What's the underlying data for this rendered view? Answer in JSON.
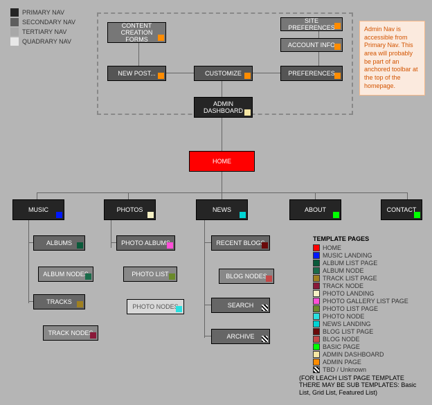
{
  "nav_legend": [
    {
      "label": "PRIMARY NAV",
      "color": "#252525"
    },
    {
      "label": "SECONDARY NAV",
      "color": "#5e5e5e"
    },
    {
      "label": "TERTIARY NAV",
      "color": "#a8a8a8"
    },
    {
      "label": "QUADRARY NAV",
      "color": "#e8e8e8"
    }
  ],
  "annotation": "Admin Nav is accessible from Primary Nav. This area will probably be part of an anchored toolbar at the top of the homepage.",
  "nodes": {
    "content_creation": {
      "label": "CONTENT CREATION FORMS",
      "bg": "#777",
      "badge": "#ff8c00"
    },
    "site_prefs": {
      "label": "SITE PREFERENCES",
      "bg": "#777",
      "badge": "#ff8c00"
    },
    "account_info": {
      "label": "ACCOUNT INFO",
      "bg": "#777",
      "badge": "#ff8c00"
    },
    "new_post": {
      "label": "NEW POST...",
      "bg": "#555",
      "badge": "#ff8c00"
    },
    "customize": {
      "label": "CUSTOMIZE",
      "bg": "#555",
      "badge": "#ff8c00"
    },
    "preferences": {
      "label": "PREFERENCES",
      "bg": "#555",
      "badge": "#ff8c00"
    },
    "admin_dash": {
      "label": "ADMIN DASHBOARD",
      "bg": "#252525",
      "badge": "#f5e6a3"
    },
    "home": {
      "label": "HOME",
      "bg": "#ff0000",
      "badge": ""
    },
    "music": {
      "label": "MUSIC",
      "bg": "#252525",
      "badge": "#0018ff"
    },
    "photos": {
      "label": "PHOTOS",
      "bg": "#252525",
      "badge": "#f5f0c4"
    },
    "news": {
      "label": "NEWS",
      "bg": "#252525",
      "badge": "#00d4d4"
    },
    "about": {
      "label": "ABOUT",
      "bg": "#252525",
      "badge": "#00ff00"
    },
    "contact": {
      "label": "CONTACT",
      "bg": "#252525",
      "badge": "#00ff00"
    },
    "albums": {
      "label": "ALBUMS",
      "bg": "#666",
      "badge": "#0a5a3a"
    },
    "album_nodes": {
      "label": "ALBUM NODES",
      "bg": "#888",
      "badge": "#1a6b4a"
    },
    "tracks": {
      "label": "TRACKS",
      "bg": "#666",
      "badge": "#a08020"
    },
    "track_nodes": {
      "label": "TRACK NODES",
      "bg": "#888",
      "badge": "#8a1a3a"
    },
    "photo_albums": {
      "label": "PHOTO ALBUMS",
      "bg": "#666",
      "badge": "#ff4fd8"
    },
    "photo_list": {
      "label": "PHOTO LIST",
      "bg": "#888",
      "badge": "#6a8a2a"
    },
    "photo_nodes": {
      "label": "PHOTO NODES",
      "bg": "#d8d8d8",
      "badge": "#2ae0e0",
      "text": "#555"
    },
    "recent_blogs": {
      "label": "RECENT BLOGS",
      "bg": "#666",
      "badge": "#6a0a0a"
    },
    "blog_nodes": {
      "label": "BLOG NODES",
      "bg": "#888",
      "badge": "#c44848"
    },
    "search": {
      "label": "SEARCH",
      "bg": "#666",
      "badge": "hatched"
    },
    "archive": {
      "label": "ARCHIVE",
      "bg": "#666",
      "badge": "hatched"
    }
  },
  "template_legend": {
    "title": "TEMPLATE PAGES",
    "items": [
      {
        "label": "HOME",
        "color": "#ff0000"
      },
      {
        "label": "MUSIC LANDING",
        "color": "#0018ff"
      },
      {
        "label": "ALBUM LIST PAGE",
        "color": "#0a5a3a"
      },
      {
        "label": "ALBUM NODE",
        "color": "#1a6b4a"
      },
      {
        "label": "TRACK LIST PAGE",
        "color": "#a08020"
      },
      {
        "label": "TRACK NODE",
        "color": "#8a1a3a"
      },
      {
        "label": "PHOTO LANDING",
        "color": "#f5f0c4"
      },
      {
        "label": "PHOTO GALLERY LIST PAGE",
        "color": "#ff4fd8"
      },
      {
        "label": "PHOTO LIST PAGE",
        "color": "#6a8a2a"
      },
      {
        "label": "PHOTO NODE",
        "color": "#2ae0e0"
      },
      {
        "label": "NEWS LANDING",
        "color": "#00d4d4"
      },
      {
        "label": "BLOG LIST PAGE",
        "color": "#6a0a0a"
      },
      {
        "label": "BLOG NODE",
        "color": "#c44848"
      },
      {
        "label": "BASIC PAGE",
        "color": "#00ff00"
      },
      {
        "label": "ADMIN DASHBOARD",
        "color": "#f5e6a3"
      },
      {
        "label": "ADMIN PAGE",
        "color": "#ff8c00"
      },
      {
        "label": "TBD / Unknown",
        "color": "hatched"
      }
    ]
  },
  "footnote": "(FOR LEACH LIST PAGE TEMPLATE THERE MAY BE SUB TEMPLATES: Basic List, Grid List, Featured List)"
}
